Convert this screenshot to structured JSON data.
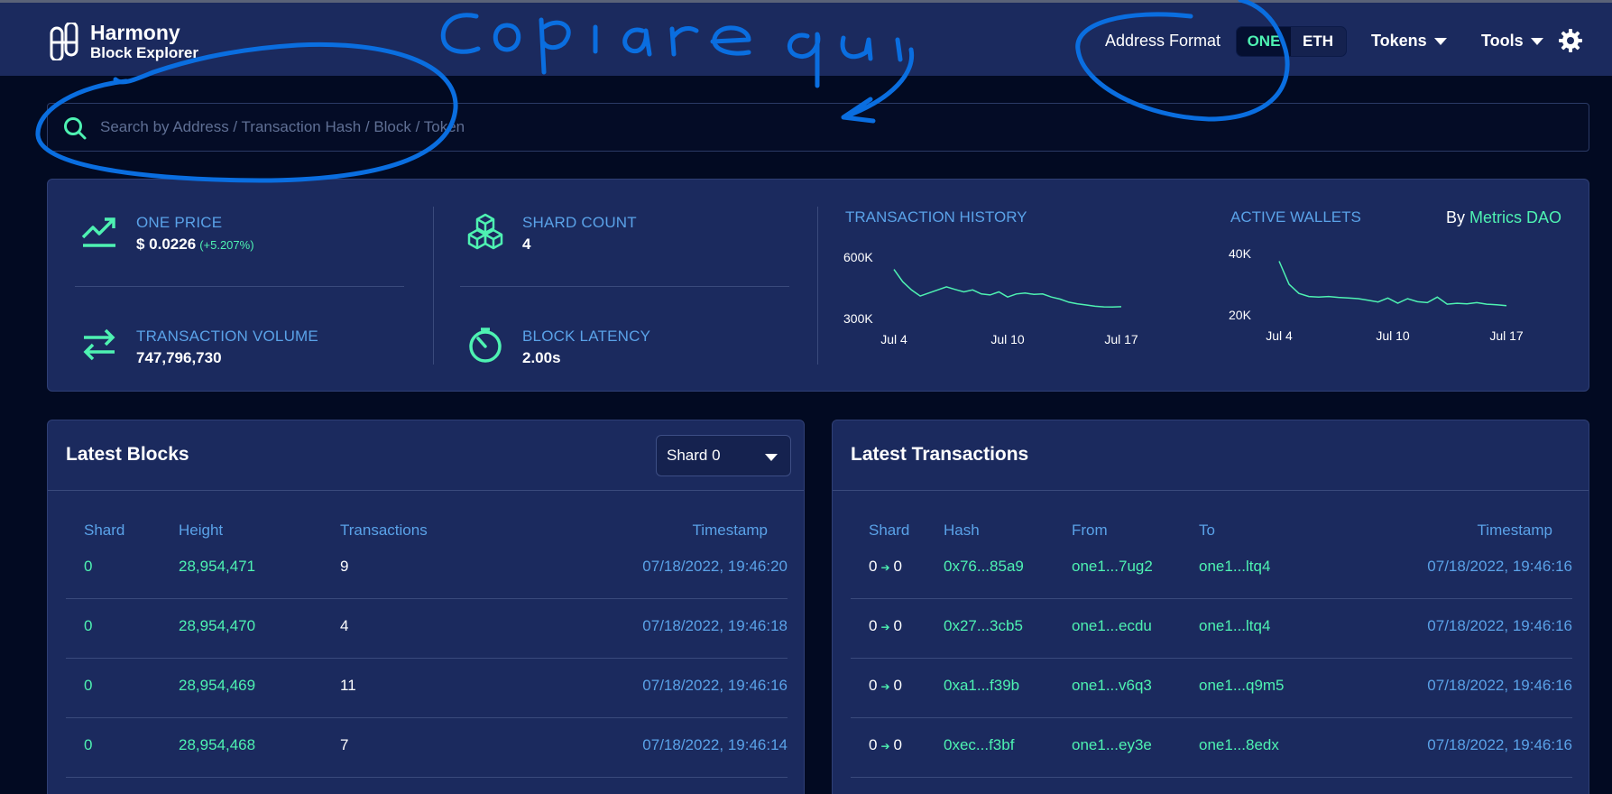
{
  "header": {
    "logo_title": "Harmony",
    "logo_subtitle": "Block Explorer",
    "address_format_label": "Address Format",
    "format_options": [
      "ONE",
      "ETH"
    ],
    "format_selected": "ONE",
    "tokens_label": "Tokens",
    "tools_label": "Tools"
  },
  "search": {
    "placeholder": "Search by Address / Transaction Hash / Block / Token"
  },
  "stats": {
    "one_price_label": "ONE PRICE",
    "one_price_value": "$ 0.0226",
    "one_price_change": "(+5.207%)",
    "shard_count_label": "SHARD COUNT",
    "shard_count_value": "4",
    "tx_volume_label": "TRANSACTION VOLUME",
    "tx_volume_value": "747,796,730",
    "block_latency_label": "BLOCK LATENCY",
    "block_latency_value": "2.00s",
    "metrics_prefix": "By",
    "metrics_link": "Metrics DAO"
  },
  "chart_data": [
    {
      "type": "line",
      "title": "TRANSACTION HISTORY",
      "x_ticks": [
        "Jul 4",
        "Jul 10",
        "Jul 17"
      ],
      "y_ticks": [
        "600K",
        "300K"
      ],
      "ylim": [
        300000,
        600000
      ],
      "values": [
        540000,
        480000,
        440000,
        410000,
        425000,
        440000,
        455000,
        442000,
        430000,
        440000,
        420000,
        415000,
        430000,
        405000,
        420000,
        425000,
        418000,
        420000,
        405000,
        395000,
        380000,
        372000,
        366000,
        360000,
        357000,
        356000,
        358000
      ]
    },
    {
      "type": "line",
      "title": "ACTIVE WALLETS",
      "x_ticks": [
        "Jul 4",
        "Jul 10",
        "Jul 17"
      ],
      "y_ticks": [
        "40K",
        "20K"
      ],
      "ylim": [
        20000,
        40000
      ],
      "values": [
        37500,
        30000,
        27000,
        26000,
        25800,
        26000,
        25700,
        25500,
        25300,
        24800,
        24200,
        25500,
        23800,
        25300,
        24300,
        24000,
        25800,
        23500,
        23800,
        23600,
        24000,
        23500,
        23300,
        23000
      ]
    }
  ],
  "latest_blocks": {
    "title": "Latest Blocks",
    "shard_select_value": "Shard 0",
    "columns": [
      "Shard",
      "Height",
      "Transactions",
      "Timestamp"
    ],
    "rows": [
      {
        "shard": "0",
        "height": "28,954,471",
        "transactions": "9",
        "timestamp": "07/18/2022, 19:46:20"
      },
      {
        "shard": "0",
        "height": "28,954,470",
        "transactions": "4",
        "timestamp": "07/18/2022, 19:46:18"
      },
      {
        "shard": "0",
        "height": "28,954,469",
        "transactions": "11",
        "timestamp": "07/18/2022, 19:46:16"
      },
      {
        "shard": "0",
        "height": "28,954,468",
        "transactions": "7",
        "timestamp": "07/18/2022, 19:46:14"
      }
    ]
  },
  "latest_transactions": {
    "title": "Latest Transactions",
    "columns": [
      "Shard",
      "Hash",
      "From",
      "To",
      "Timestamp"
    ],
    "rows": [
      {
        "shard_from": "0",
        "shard_to": "0",
        "hash": "0x76...85a9",
        "from": "one1...7ug2",
        "to": "one1...ltq4",
        "timestamp": "07/18/2022, 19:46:16"
      },
      {
        "shard_from": "0",
        "shard_to": "0",
        "hash": "0x27...3cb5",
        "from": "one1...ecdu",
        "to": "one1...ltq4",
        "timestamp": "07/18/2022, 19:46:16"
      },
      {
        "shard_from": "0",
        "shard_to": "0",
        "hash": "0xa1...f39b",
        "from": "one1...v6q3",
        "to": "one1...q9m5",
        "timestamp": "07/18/2022, 19:46:16"
      },
      {
        "shard_from": "0",
        "shard_to": "0",
        "hash": "0xec...f3bf",
        "from": "one1...ey3e",
        "to": "one1...8edx",
        "timestamp": "07/18/2022, 19:46:16"
      }
    ]
  },
  "annotation": {
    "handwritten_text": "Copiare qui",
    "color": "#0a6ee0"
  }
}
